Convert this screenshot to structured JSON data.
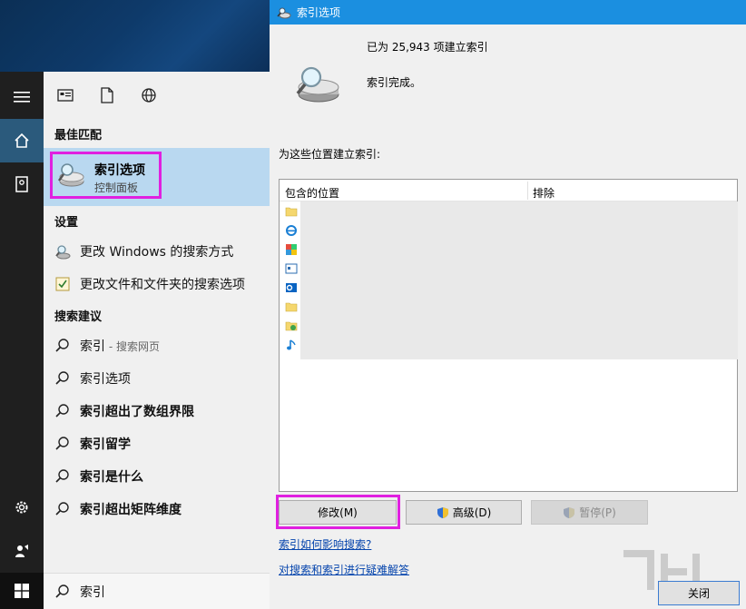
{
  "start_menu": {
    "best_match_heading": "最佳匹配",
    "best_match": {
      "title": "索引选项",
      "subtitle": "控制面板"
    },
    "settings_heading": "设置",
    "settings_items": [
      {
        "label": "更改 Windows 的搜索方式"
      },
      {
        "label": "更改文件和文件夹的搜索选项"
      }
    ],
    "suggestions_heading": "搜索建议",
    "suggestions": [
      {
        "bold": "索引",
        "rest": " - 搜索网页"
      },
      {
        "bold": "索引选项",
        "rest": ""
      },
      {
        "bold": "索引超出了数组界限",
        "rest": ""
      },
      {
        "bold": "索引留学",
        "rest": ""
      },
      {
        "bold": "索引是什么",
        "rest": ""
      },
      {
        "bold": "索引超出矩阵维度",
        "rest": ""
      }
    ],
    "search_value": "索引"
  },
  "dialog": {
    "title": "索引选项",
    "indexed_count_text": "已为 25,943 项建立索引",
    "status_text": "索引完成。",
    "locations_label": "为这些位置建立索引:",
    "columns": {
      "included": "包含的位置",
      "excluded": "排除"
    },
    "buttons": {
      "modify": "修改(M)",
      "advanced": "高级(D)",
      "pause": "暂停(P)",
      "close": "关闭"
    },
    "links": {
      "how_affects": "索引如何影响搜索?",
      "troubleshoot": "对搜索和索引进行疑难解答"
    }
  },
  "colors": {
    "accent": "#1b8fe0",
    "highlight": "#e020e0",
    "selection": "#b9d8f0"
  }
}
